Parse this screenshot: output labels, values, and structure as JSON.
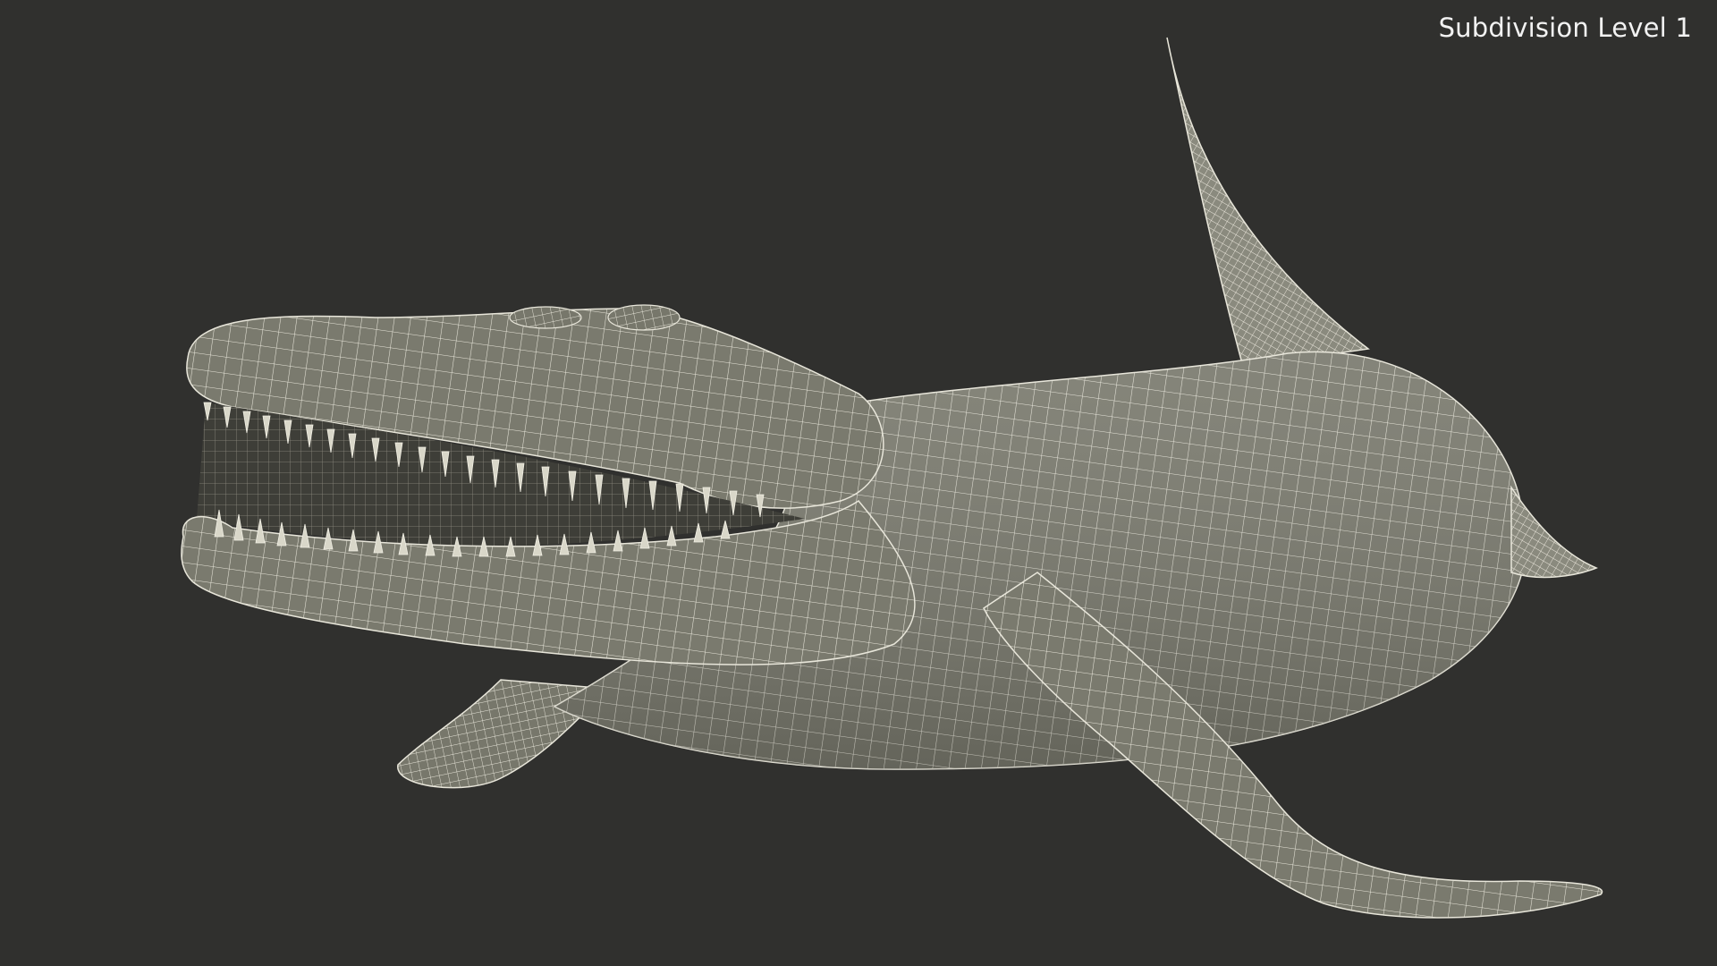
{
  "viewport": {
    "subdivision_label": "Subdivision Level 1"
  },
  "colors": {
    "background": "#30302e",
    "mesh_fill": "#7a7a6e",
    "mesh_shadow": "#5e5e55",
    "wire": "#e8e6da",
    "mouth_interior": "#3b3b35",
    "teeth": "#d9d7c9"
  }
}
